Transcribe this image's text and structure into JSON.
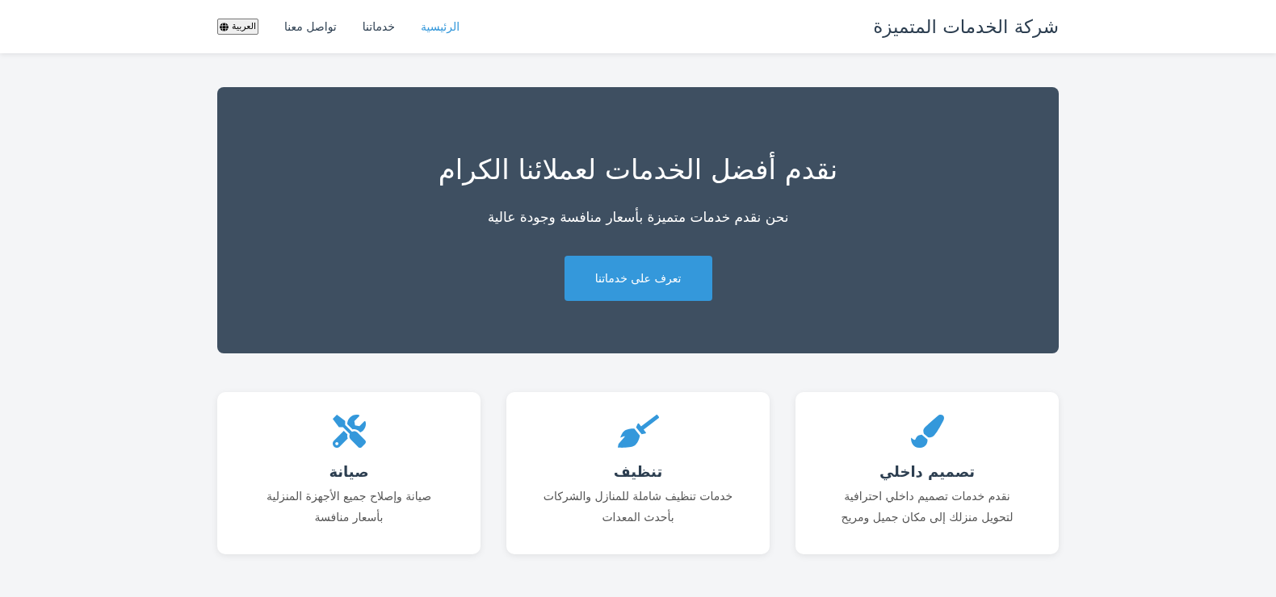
{
  "header": {
    "logo": "شركة الخدمات المتميزة",
    "nav": [
      {
        "label": "الرئيسية",
        "selected": true
      },
      {
        "label": "خدماتنا",
        "selected": false
      },
      {
        "label": "تواصل معنا",
        "selected": false
      }
    ],
    "language_button": "العربية"
  },
  "hero": {
    "title": "نقدم أفضل الخدمات لعملائنا الكرام",
    "subtitle": "نحن نقدم خدمات متميزة بأسعار منافسة وجودة عالية",
    "button": "تعرف على خدماتنا"
  },
  "services": [
    {
      "kind": "brush",
      "title": "تصميم داخلي",
      "description": "نقدم خدمات تصميم داخلي احترافية لتحويل منزلك إلى مكان جميل ومريح"
    },
    {
      "kind": "broom",
      "title": "تنظيف",
      "description": "خدمات تنظيف شاملة للمنازل والشركات بأحدث المعدات"
    },
    {
      "kind": "tools",
      "title": "صيانة",
      "description": "صيانة وإصلاح جميع الأجهزة المنزلية بأسعار منافسة"
    }
  ]
}
